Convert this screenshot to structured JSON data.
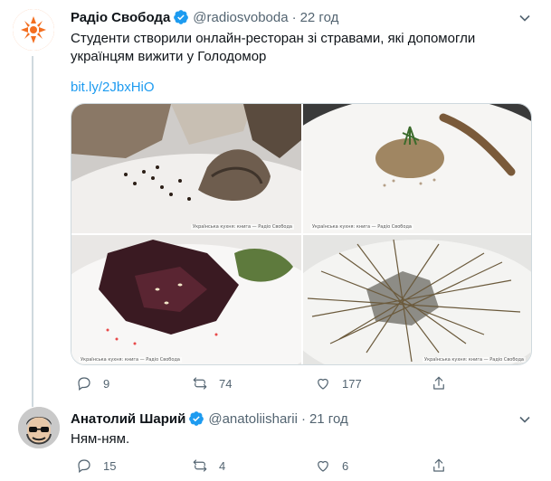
{
  "tweet1": {
    "author_name": "Радіо Свобода",
    "handle": "@radiosvoboda",
    "separator": "·",
    "time": "22 год",
    "text_line1": "Студенти створили онлайн-ресторан зі стравами, які допомогли",
    "text_line2": "українцям вижити у Голодомор",
    "link": "bit.ly/2JbxHiO",
    "image_captions": [
      "Українська кухня: книга — Радіо Свобода",
      "Українська кухня: книга — Радіо Свобода",
      "Українська кухня: книга — Радіо Свобода",
      "Українська кухня: книга — Радіо Свобода"
    ],
    "replies": "9",
    "retweets": "74",
    "likes": "177"
  },
  "tweet2": {
    "author_name": "Анатолий Шарий",
    "handle": "@anatoliisharii",
    "separator": "·",
    "time": "21 год",
    "text": "Ням-ням.",
    "replies": "15",
    "retweets": "4",
    "likes": "6"
  },
  "colors": {
    "brand_orange": "#f36f21",
    "link_blue": "#1d9bf0",
    "verified_blue": "#1d9bf0",
    "muted_gray": "#536471"
  }
}
